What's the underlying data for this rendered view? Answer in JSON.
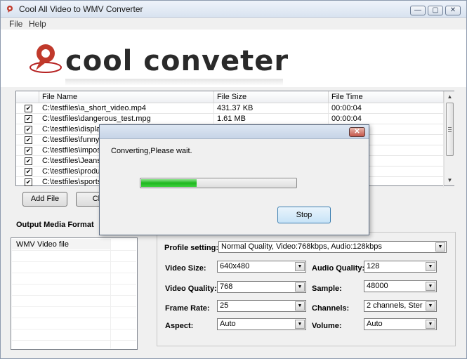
{
  "window": {
    "title": "Cool All Video to WMV Converter",
    "buttons": {
      "minimize": "—",
      "maximize": "▢",
      "close": "✕"
    }
  },
  "menu": {
    "file": "File",
    "help": "Help"
  },
  "banner": {
    "logo_text": "cool conveter"
  },
  "file_list": {
    "columns": {
      "name": "File Name",
      "size": "File Size",
      "time": "File Time"
    },
    "rows": [
      {
        "name": "C:\\testfiles\\a_short_video.mp4",
        "size": "431.37 KB",
        "time": "00:00:04"
      },
      {
        "name": "C:\\testfiles\\dangerous_test.mpg",
        "size": "1.61 MB",
        "time": "00:00:04"
      },
      {
        "name": "C:\\testfiles\\display.3",
        "size": "",
        "time": ""
      },
      {
        "name": "C:\\testfiles\\funnypla",
        "size": "",
        "time": ""
      },
      {
        "name": "C:\\testfiles\\impossib",
        "size": "",
        "time": ""
      },
      {
        "name": "C:\\testfiles\\Jeans.as",
        "size": "",
        "time": ""
      },
      {
        "name": "C:\\testfiles\\producti",
        "size": "",
        "time": ""
      },
      {
        "name": "C:\\testfiles\\sports_c",
        "size": "",
        "time": ""
      }
    ]
  },
  "buttons": {
    "add_file": "Add File",
    "clear": "Cle"
  },
  "output_format": {
    "label": "Output Media Format",
    "items": [
      "WMV Video file"
    ]
  },
  "settings": {
    "profile_label": "Profile setting:",
    "profile_value": "Normal Quality, Video:768kbps, Audio:128kbps",
    "video_size_label": "Video Size:",
    "video_size_value": "640x480",
    "video_quality_label": "Video Quality:",
    "video_quality_value": "768",
    "frame_rate_label": "Frame Rate:",
    "frame_rate_value": "25",
    "aspect_label": "Aspect:",
    "aspect_value": "Auto",
    "audio_quality_label": "Audio Quality:",
    "audio_quality_value": "128",
    "sample_label": "Sample:",
    "sample_value": "48000",
    "channels_label": "Channels:",
    "channels_value": "2 channels, Ster",
    "volume_label": "Volume:",
    "volume_value": "Auto"
  },
  "dialog": {
    "close": "✕",
    "message": "Converting,Please wait.",
    "progress": 0.36,
    "stop_label": "Stop"
  }
}
